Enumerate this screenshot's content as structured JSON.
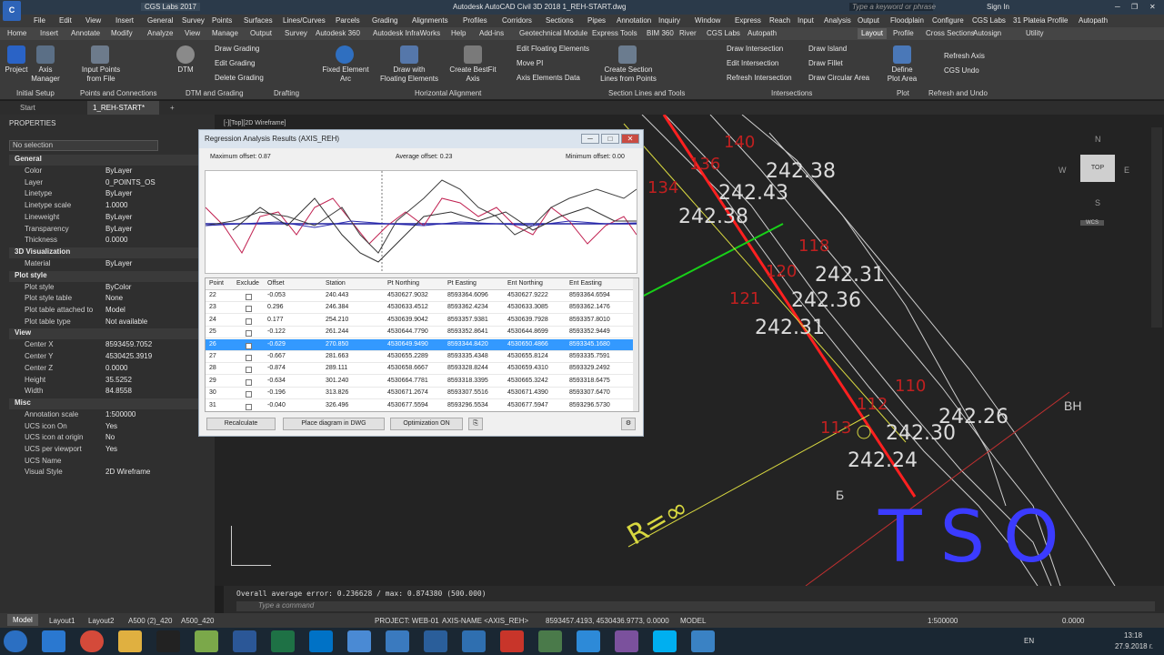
{
  "titlebar": {
    "qat_workspace": "CGS Labs 2017",
    "title": "Autodesk AutoCAD Civil 3D 2018    1_REH-START.dwg",
    "search_placeholder": "Type a keyword or phrase",
    "signin": "Sign In"
  },
  "menu": [
    "File",
    "Edit",
    "View",
    "Insert",
    "General",
    "Survey",
    "Points",
    "Surfaces",
    "Lines/Curves",
    "Parcels",
    "Grading",
    "Alignments",
    "Profiles",
    "Corridors",
    "Sections",
    "Pipes",
    "Annotation",
    "Inquiry",
    "Window",
    "Express",
    "Reach",
    "Input",
    "Analysis",
    "Output",
    "Floodplain",
    "Configure",
    "CGS Labs",
    "31 Plateia Profile",
    "Autopath"
  ],
  "ribbon_tabs": [
    "Home",
    "Insert",
    "Annotate",
    "Modify",
    "Analyze",
    "View",
    "Manage",
    "Output",
    "Survey",
    "Autodesk 360",
    "Autodesk InfraWorks",
    "Help",
    "Add-ins",
    "Geotechnical Module",
    "Express Tools",
    "BIM 360",
    "River",
    "CGS Labs",
    "Autopath",
    "Layout",
    "Profile",
    "Cross Sections",
    "Autosign",
    "Utility"
  ],
  "active_tab": "Layout",
  "ribbon": {
    "project": "Project",
    "axis_manager": "Axis\nManager",
    "input_points": "Input Points\nfrom File",
    "dtm": "DTM",
    "draw_grading": "Draw Grading",
    "edit_grading": "Edit Grading",
    "delete_grading": "Delete Grading",
    "fixed_element": "Fixed Element\nArc",
    "draw_floating": "Draw with\nFloating Elements",
    "bestfit": "Create BestFit\nAxis",
    "edit_floating": "Edit Floating Elements",
    "move_pi": "Move PI",
    "axis_data": "Axis Elements Data",
    "create_section": "Create Section\nLines from Points",
    "draw_intersection": "Draw Intersection",
    "edit_intersection": "Edit Intersection",
    "refresh_intersection": "Refresh Intersection",
    "draw_island": "Draw Island",
    "draw_fillet": "Draw Fillet",
    "draw_circular": "Draw Circular Area",
    "define_plot": "Define\nPlot Area",
    "refresh_axis": "Refresh Axis",
    "cgs_undo": "CGS Undo",
    "panels": [
      "Initial Setup",
      "Points and Connections",
      "DTM and Grading",
      "Drafting",
      "Horizontal Alignment",
      "Section Lines and Tools",
      "Intersections",
      "Plot",
      "Refresh and Undo"
    ]
  },
  "doc_tabs": [
    "Start",
    "1_REH-START*"
  ],
  "properties": {
    "title": "PROPERTIES",
    "selection": "No selection",
    "sections": [
      {
        "name": "General",
        "rows": [
          [
            "Color",
            "ByLayer"
          ],
          [
            "Layer",
            "0_POINTS_OS"
          ],
          [
            "Linetype",
            "ByLayer"
          ],
          [
            "Linetype scale",
            "1.0000"
          ],
          [
            "Lineweight",
            "ByLayer"
          ],
          [
            "Transparency",
            "ByLayer"
          ],
          [
            "Thickness",
            "0.0000"
          ]
        ]
      },
      {
        "name": "3D Visualization",
        "rows": [
          [
            "Material",
            "ByLayer"
          ]
        ]
      },
      {
        "name": "Plot style",
        "rows": [
          [
            "Plot style",
            "ByColor"
          ],
          [
            "Plot style table",
            "None"
          ],
          [
            "Plot table attached to",
            "Model"
          ],
          [
            "Plot table type",
            "Not available"
          ]
        ]
      },
      {
        "name": "View",
        "rows": [
          [
            "Center X",
            "8593459.7052"
          ],
          [
            "Center Y",
            "4530425.3919"
          ],
          [
            "Center Z",
            "0.0000"
          ],
          [
            "Height",
            "35.5252"
          ],
          [
            "Width",
            "84.8558"
          ]
        ]
      },
      {
        "name": "Misc",
        "rows": [
          [
            "Annotation scale",
            "1:500000"
          ],
          [
            "UCS icon On",
            "Yes"
          ],
          [
            "UCS icon at origin",
            "No"
          ],
          [
            "UCS per viewport",
            "Yes"
          ],
          [
            "UCS Name",
            ""
          ],
          [
            "Visual Style",
            "2D Wireframe"
          ]
        ]
      }
    ]
  },
  "viewport_label": "[-][Top][2D Wireframe]",
  "viewcube": {
    "top": "TOP",
    "n": "N",
    "s": "S",
    "e": "E",
    "w": "W",
    "wcs": "WCS"
  },
  "drawing_labels": {
    "stations": [
      "140",
      "136",
      "134",
      "118",
      "120",
      "121",
      "110",
      "112",
      "113"
    ],
    "elevs": [
      "242.38",
      "242.43",
      "242.38",
      "242.31",
      "242.36",
      "242.31",
      "242.26",
      "242.30",
      "242.24"
    ],
    "bh": "BH",
    "b": "Б",
    "r": "R=∞",
    "tso": "TSO"
  },
  "dialog": {
    "title": "Regression Analysis Results (AXIS_REH)",
    "max_offset": "Maximum offset:  0.87",
    "avg_offset": "Average offset:  0.23",
    "min_offset": "Minimum offset:  0.00",
    "columns": [
      "Point",
      "Exclude",
      "Offset",
      "Station",
      "Pt Northing",
      "Pt Easting",
      "Ent Northing",
      "Ent Easting"
    ],
    "rows": [
      [
        "22",
        "-0.053",
        "240.443",
        "4530627.9032",
        "8593364.6096",
        "4530627.9222",
        "8593364.6594"
      ],
      [
        "23",
        "0.296",
        "246.384",
        "4530633.4512",
        "8593362.4234",
        "4530633.3085",
        "8593362.1476"
      ],
      [
        "24",
        "0.177",
        "254.210",
        "4530639.9042",
        "8593357.9381",
        "4530639.7928",
        "8593357.8010"
      ],
      [
        "25",
        "-0.122",
        "261.244",
        "4530644.7790",
        "8593352.8641",
        "4530644.8699",
        "8593352.9449"
      ],
      [
        "26",
        "-0.629",
        "270.850",
        "4530649.9490",
        "8593344.8420",
        "4530650.4866",
        "8593345.1680"
      ],
      [
        "27",
        "-0.667",
        "281.663",
        "4530655.2289",
        "8593335.4348",
        "4530655.8124",
        "8593335.7591"
      ],
      [
        "28",
        "-0.874",
        "289.111",
        "4530658.6667",
        "8593328.8244",
        "4530659.4310",
        "8593329.2492"
      ],
      [
        "29",
        "-0.634",
        "301.240",
        "4530664.7781",
        "8593318.3395",
        "4530665.3242",
        "8593318.6475"
      ],
      [
        "30",
        "-0.196",
        "313.826",
        "4530671.2674",
        "8593307.5516",
        "4530671.4390",
        "8593307.6470"
      ],
      [
        "31",
        "-0.040",
        "326.496",
        "4530677.5594",
        "8593296.5534",
        "4530677.5947",
        "8593296.5730"
      ]
    ],
    "selected_row": "26",
    "btn_recalculate": "Recalculate",
    "btn_place": "Place diagram in DWG",
    "btn_optimization": "Optimization ON"
  },
  "command": {
    "history": "Overall average error: 0.236628 / max: 0.874380 (500.000)",
    "placeholder": "Type a command"
  },
  "status": {
    "model_tab": "Model",
    "layout1": "Layout1",
    "layout2": "Layout2",
    "a500a": "A500 (2)_420",
    "a500b": "A500_420",
    "project": "PROJECT: WEB-01",
    "axis": "AXIS-NAME <AXIS_REH>",
    "coords": "8593457.4193, 4530436.9773, 0.0000",
    "model": "MODEL",
    "scale": "1:500000",
    "zero": "0.0000"
  },
  "taskbar": {
    "lang": "EN",
    "time": "13:18",
    "date": "27.9.2018 г."
  },
  "colors": {
    "accent": "#3399ff",
    "red_line": "#ff2020",
    "green_line": "#18d018",
    "yellow_line": "#d8d840",
    "blue_text": "#3b3bff"
  }
}
